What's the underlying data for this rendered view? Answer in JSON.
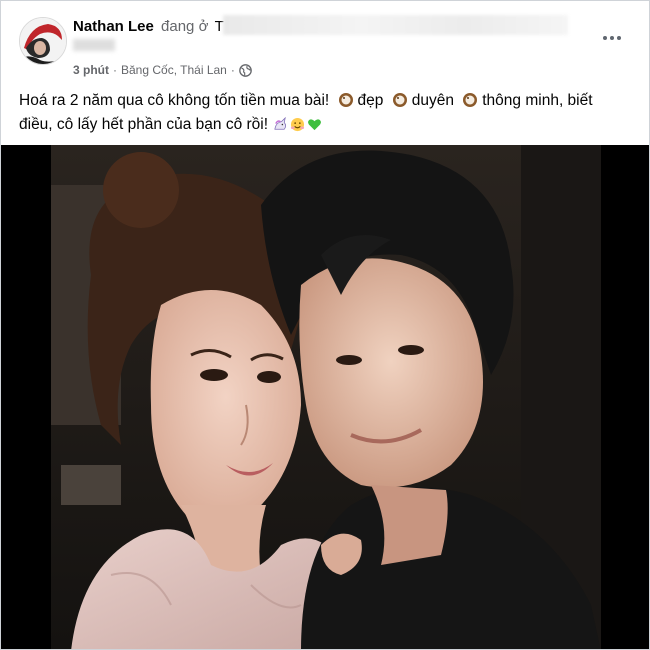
{
  "author": {
    "name": "Nathan Lee",
    "verb": "đang ở",
    "place_partial": "T"
  },
  "meta": {
    "time": "3 phút",
    "separator": "·",
    "location": "Băng Cốc, Thái Lan",
    "privacy_icon": "globe-icon"
  },
  "caption": {
    "part1": "Hoá ra 2 năm qua cô không tốn tiền mua bài!",
    "word1": "đẹp",
    "word2": "duyên",
    "word3": "thông minh, biết",
    "line2": "điều, cô lấy hết phần của bạn cô rồi!"
  },
  "icons": {
    "more": "more-options-icon",
    "coconut": "coconut-emoji-icon",
    "unicorn": "unicorn-emoji-icon",
    "hug_face": "hugging-face-emoji-icon",
    "green_heart": "green-heart-emoji-icon"
  },
  "colors": {
    "text": "#050505",
    "secondary": "#65676b",
    "photo_bg": "#000000"
  }
}
